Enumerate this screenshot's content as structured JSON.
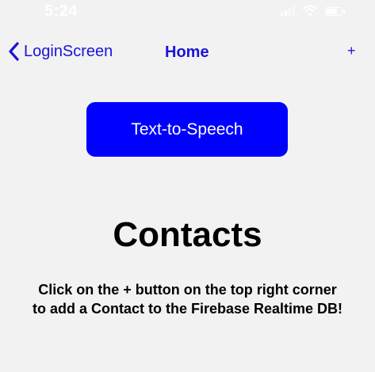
{
  "status_bar": {
    "time": "5:24",
    "icons": [
      "cellular-signal-icon",
      "wifi-icon",
      "battery-icon"
    ]
  },
  "nav": {
    "back_label": "LoginScreen",
    "title": "Home",
    "add_label": "+"
  },
  "main": {
    "tts_button_label": "Text-to-Speech",
    "heading": "Contacts",
    "instructions": "Click on the + button on the top right corner to add a Contact to the Firebase Realtime DB!"
  },
  "colors": {
    "background": "#f2f2f2",
    "accent": "#1a14d8",
    "button": "#0000ff",
    "button_text": "#ffffff",
    "text": "#000000"
  }
}
